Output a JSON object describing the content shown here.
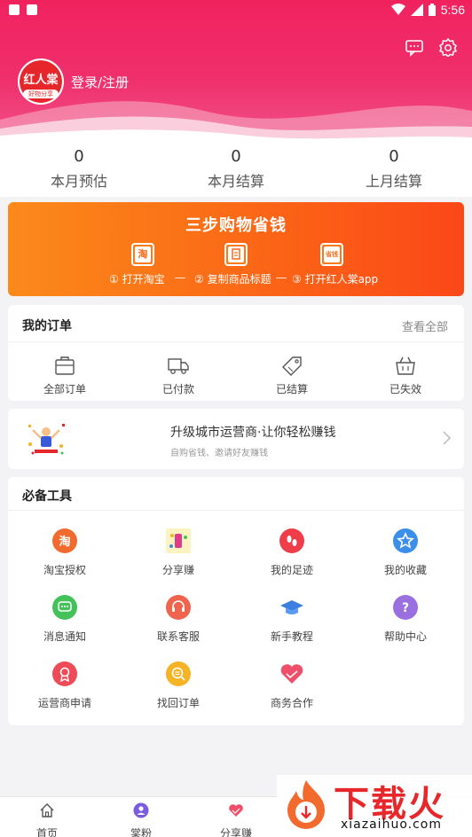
{
  "status_bar": {
    "time": "5:56"
  },
  "header": {
    "login_text": "登录/注册",
    "avatar_line1": "红人棠",
    "avatar_line2": "好物分享"
  },
  "stats": [
    {
      "value": "0",
      "label": "本月预估"
    },
    {
      "value": "0",
      "label": "本月结算"
    },
    {
      "value": "0",
      "label": "上月结算"
    }
  ],
  "banner": {
    "title": "三步购物省钱",
    "steps": [
      {
        "icon_text": "淘",
        "label": "① 打开淘宝"
      },
      {
        "icon_text": "",
        "label": "② 复制商品标题"
      },
      {
        "icon_text": "省钱",
        "label": "③ 打开红人棠app"
      }
    ]
  },
  "orders": {
    "title": "我的订单",
    "view_all": "查看全部",
    "items": [
      {
        "label": "全部订单",
        "icon": "bag-icon"
      },
      {
        "label": "已付款",
        "icon": "truck-icon"
      },
      {
        "label": "已结算",
        "icon": "tag-icon"
      },
      {
        "label": "已失效",
        "icon": "basket-icon"
      }
    ]
  },
  "promo": {
    "title": "升级城市运营商·让你轻松赚钱",
    "subtitle": "自购省钱、邀请好友赚钱"
  },
  "tools": {
    "title": "必备工具",
    "items": [
      {
        "label": "淘宝授权",
        "icon": "taobao-icon",
        "color": "#f26a2e"
      },
      {
        "label": "分享赚",
        "icon": "share-earn-icon",
        "color": "#f5d84a"
      },
      {
        "label": "我的足迹",
        "icon": "footprint-icon",
        "color": "#ef3e4a"
      },
      {
        "label": "我的收藏",
        "icon": "star-icon",
        "color": "#3b8fe8"
      },
      {
        "label": "消息通知",
        "icon": "message-icon",
        "color": "#44c25a"
      },
      {
        "label": "联系客服",
        "icon": "headset-icon",
        "color": "#f0634c"
      },
      {
        "label": "新手教程",
        "icon": "graduation-cap-icon",
        "color": "#3b7fe0"
      },
      {
        "label": "帮助中心",
        "icon": "help-icon",
        "color": "#9a6fe0"
      },
      {
        "label": "运营商申请",
        "icon": "badge-icon",
        "color": "#ef4a58"
      },
      {
        "label": "找回订单",
        "icon": "search-order-icon",
        "color": "#f5b326"
      },
      {
        "label": "商务合作",
        "icon": "handshake-icon",
        "color": "#ef4f6b"
      }
    ]
  },
  "bottom_nav": [
    {
      "label": "首页",
      "icon": "home-icon"
    },
    {
      "label": "棠粉",
      "icon": "user-icon"
    },
    {
      "label": "分享赚",
      "icon": "heart-hands-icon"
    }
  ],
  "watermark": {
    "text": "下载火",
    "url": "xiazaihuo.com"
  }
}
